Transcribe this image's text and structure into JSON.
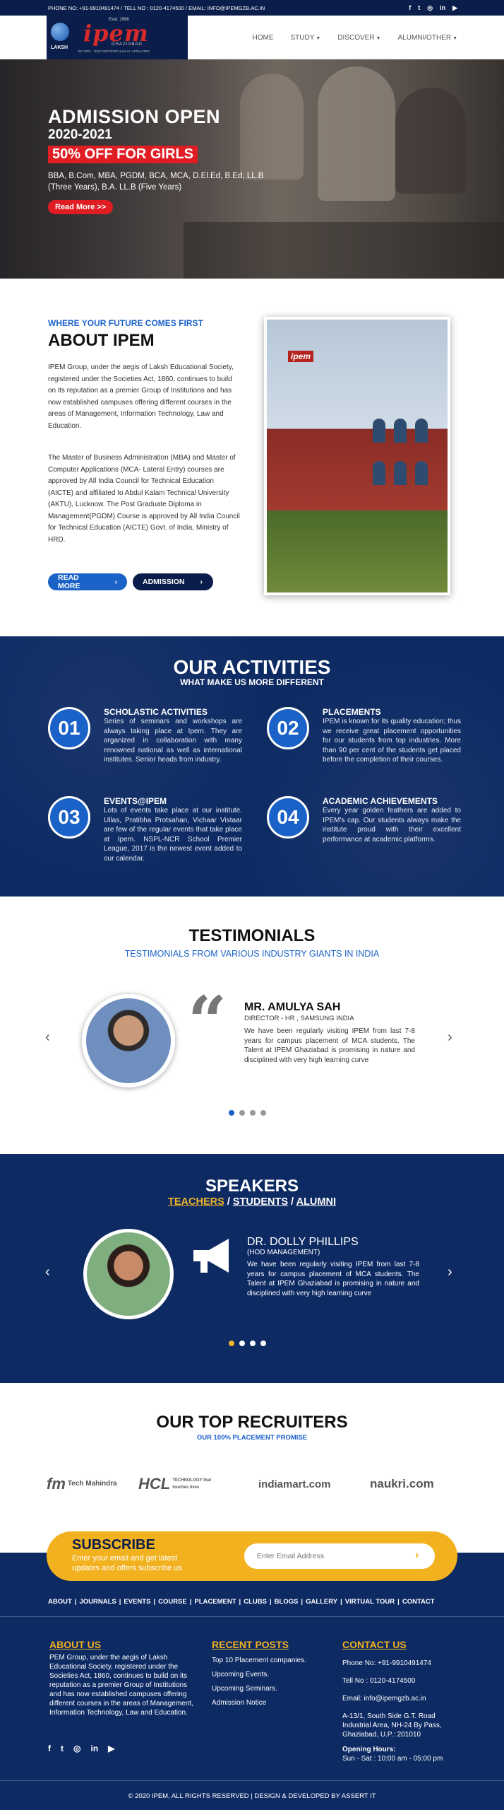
{
  "topbar": {
    "contact": "PHONE NO: +91-9910491474 / TELL NO : 0120-4174500 / EMAIL: INFO@IPEMGZB.AC.IN",
    "social_icons": [
      "facebook-icon",
      "twitter-icon",
      "instagram-icon",
      "linkedin-icon",
      "youtube-icon"
    ]
  },
  "logo": {
    "est": "Estd. 1996",
    "name": "ipem",
    "city": "GHAZIABAD",
    "group": "LAKSH",
    "tagline": "ISO 9001 : 2015 CERTIFIED & NAAC AFFILIATED"
  },
  "nav": {
    "items": [
      "HOME",
      "STUDY",
      "DISCOVER",
      "ALUMNI/OTHER"
    ]
  },
  "hero": {
    "title": "ADMISSION OPEN",
    "year": "2020-2021",
    "offer": "50% OFF FOR GIRLS",
    "courses": "BBA, B.Com, MBA, PGDM, BCA, MCA, D.El.Ed, B.Ed, LL.B (Three Years), B.A. LL.B (Five Years)",
    "cta": "Read More >>"
  },
  "about": {
    "kicker": "WHERE YOUR FUTURE COMES FIRST",
    "title": "ABOUT IPEM",
    "p1": "IPEM Group, under the aegis of Laksh Educational Society, registered under the Societies Act, 1860, continues to build on its reputation as a premier Group of Institutions and has now established campuses offering different courses in the areas of Management, Information Technology, Law and Education.",
    "p2": "The Master of Business Administration (MBA) and Master of Computer Applications (MCA- Lateral Entry) courses are approved by All India Council for Technical Education (AICTE) and affiliated to Abdul Kalam Technical University (AKTU), Lucknow. The Post Graduate Diploma in Management(PGDM) Course is approved by All India Council for Technical Education (AICTE) Govt. of India, Ministry of HRD.",
    "btn_readmore": "READ MORE",
    "btn_admission": "ADMISSION",
    "photo_sign": "ipem"
  },
  "activities": {
    "title": "OUR ACTIVITIES",
    "subtitle": "WHAT MAKE US MORE DIFFERENT",
    "items": [
      {
        "num": "01",
        "title": "SCHOLASTIC ACTIVITIES",
        "desc": "Series of seminars and workshops are always taking place at Ipem. They are organized in collaboration with many renowned national as well as international institutes. Senior heads from industry."
      },
      {
        "num": "02",
        "title": "PLACEMENTS",
        "desc": "IPEM is known for its quality education; thus we receive great placement opportunities for our students from top industries. More than 90 per cent of the students get placed before the completion of their courses."
      },
      {
        "num": "03",
        "title": "EVENTS@IPEM",
        "desc": "Lots of events take place at our institute. Ullas, Pratibha Protsahan, Vichaar Vistaar are few of the regular events that take place at Ipem. NSPL-NCR School Premier League, 2017 is the newest event added to our calendar."
      },
      {
        "num": "04",
        "title": "ACADEMIC ACHIEVEMENTS",
        "desc": "Every year golden feathers are added to IPEM's cap. Our students always make the institute proud with their excellent performance at academic platforms."
      }
    ]
  },
  "testimonials": {
    "title": "TESTIMONIALS",
    "subtitle": "TESTIMONIALS FROM VARIOUS INDUSTRY GIANTS IN INDIA",
    "name": "MR. AMULYA SAH",
    "role": "DIRECTOR - HR , SAMSUNG INDIA",
    "text": "We have been regularly visiting IPEM from last 7-8 years for campus placement of MCA students. The Talent at IPEM Ghaziabad is promising in nature and disciplined with very high learning curve",
    "quote": "“",
    "prev": "‹",
    "next": "›",
    "dots": 4,
    "active_dot": 0
  },
  "speakers": {
    "title": "SPEAKERS",
    "cat_teachers": "TEACHERS",
    "cat_sep": " / ",
    "cat_students": "STUDENTS",
    "cat_alumni": "ALUMNI",
    "name": "DR. DOLLY PHILLIPS",
    "role": "(HOD MANAGEMENT)",
    "text": "We have been regularly visiting IPEM from last 7-8 years for campus placement of MCA students. The Talent at IPEM Ghaziabad is promising in nature and disciplined with very high learning curve",
    "prev": "‹",
    "next": "›",
    "dots": 4,
    "active_dot": 0
  },
  "recruiters": {
    "title": "OUR TOP RECRUITERS",
    "subtitle": "OUR 100% PLACEMENT PROMISE",
    "logos": [
      {
        "mark": "fm",
        "name": "Tech Mahindra"
      },
      {
        "mark": "HCL",
        "name": "TECHNOLOGY that touches lives"
      },
      {
        "mark": "indiamart.com",
        "name": ""
      },
      {
        "mark": "naukri.com",
        "name": ""
      }
    ]
  },
  "subscribe": {
    "title": "SUBSCRIBE",
    "text": "Enter your email and get latest updates and offers subscribe us",
    "placeholder": "Enter Email Address",
    "go": "›"
  },
  "footer": {
    "links": [
      "ABOUT",
      "JOURNALS",
      "EVENTS",
      "COURSE",
      "PLACEMENT",
      "CLUBS",
      "BLOGS",
      "GALLERY",
      "VIRTUAL TOUR",
      "CONTACT"
    ],
    "about_title": "ABOUT US",
    "about_text": "PEM Group, under the aegis of Laksh Educational Society, registered under the Societies Act, 1860, continues to build on its reputation as a premier Group of Institutions and has now established campuses offering different courses in the areas of Management, Information Technology, Law and Education.",
    "posts_title": "RECENT POSTS",
    "posts": [
      "Top 10 Placement companies.",
      "Upcoming Events.",
      "Upcoming Seminars.",
      "Admission Notice"
    ],
    "contact_title": "CONTACT US",
    "phone": "Phone No: +91-9910491474",
    "tell": "Tell No : 0120-4174500",
    "email": "Email: info@ipemgzb.ac.in",
    "address": "A-13/1, South Side G.T. Road Industrial Area, NH-24 By Pass, Ghaziabad, U.P.: 201010",
    "hours_title": "Opening Hours:",
    "hours": "Sun - Sat : 10:00 am - 05:00 pm",
    "copyright": "© 2020 IPEM, ALL RIGHTS RESERVED | DESIGN & DEVELOPED BY ASSERT IT"
  }
}
